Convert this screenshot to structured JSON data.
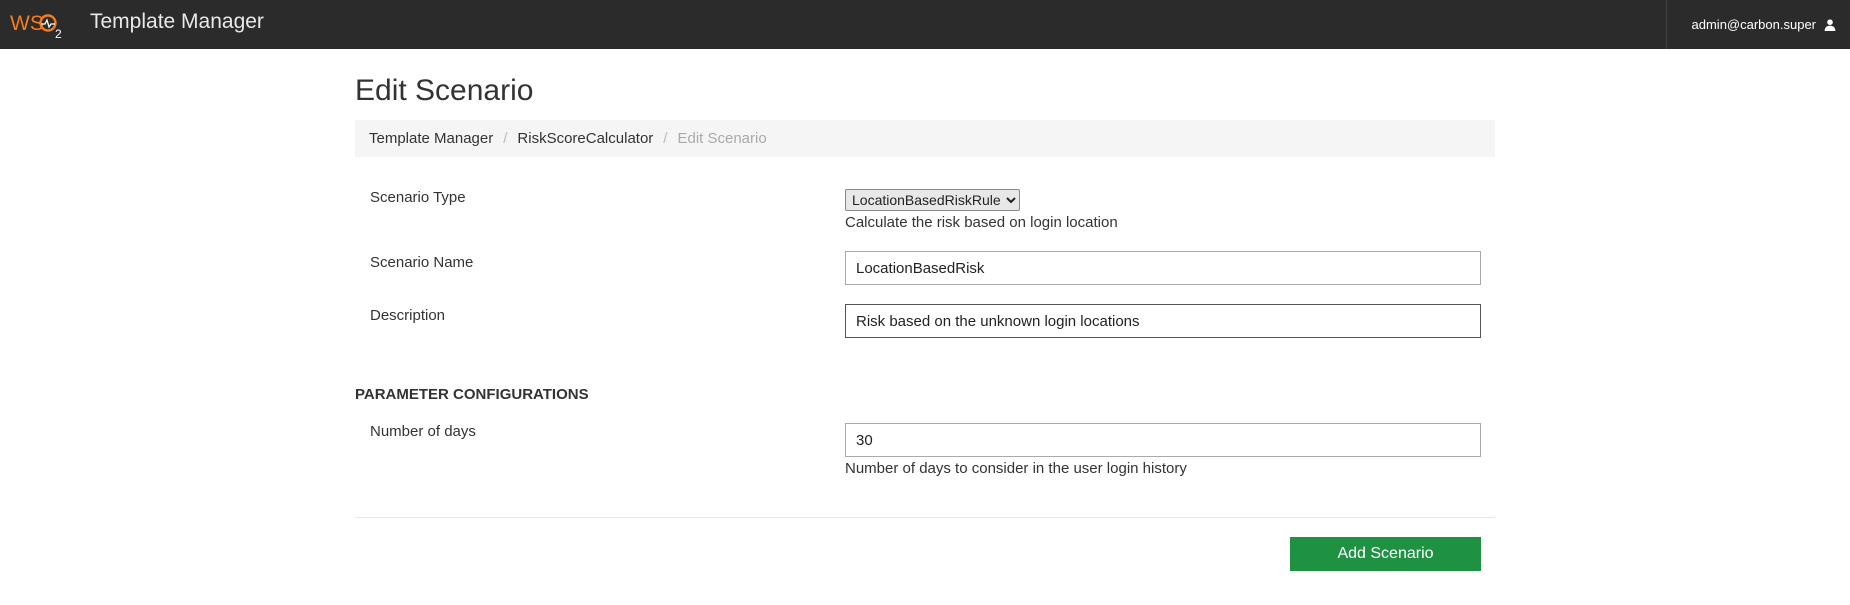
{
  "header": {
    "logo_text": "WSO2",
    "app_title": "Template Manager",
    "user": "admin@carbon.super"
  },
  "page": {
    "title": "Edit Scenario"
  },
  "breadcrumb": {
    "items": [
      "Template Manager",
      "RiskScoreCalculator"
    ],
    "active": "Edit Scenario",
    "separator": "/"
  },
  "form": {
    "scenario_type": {
      "label": "Scenario Type",
      "selected": "LocationBasedRiskRule",
      "help": "Calculate the risk based on login location"
    },
    "scenario_name": {
      "label": "Scenario Name",
      "value": "LocationBasedRisk"
    },
    "description": {
      "label": "Description",
      "value": "Risk based on the unknown login locations"
    }
  },
  "parameters": {
    "heading": "PARAMETER CONFIGURATIONS",
    "number_of_days": {
      "label": "Number of days",
      "value": "30",
      "help": "Number of days to consider in the user login history"
    }
  },
  "actions": {
    "add_label": "Add Scenario"
  },
  "colors": {
    "topbar": "#2b2b2b",
    "logo_orange": "#f47b20",
    "primary_button": "#1e9143"
  },
  "icons": {
    "user": "user-icon",
    "dropdown": "chevron-down-icon"
  }
}
